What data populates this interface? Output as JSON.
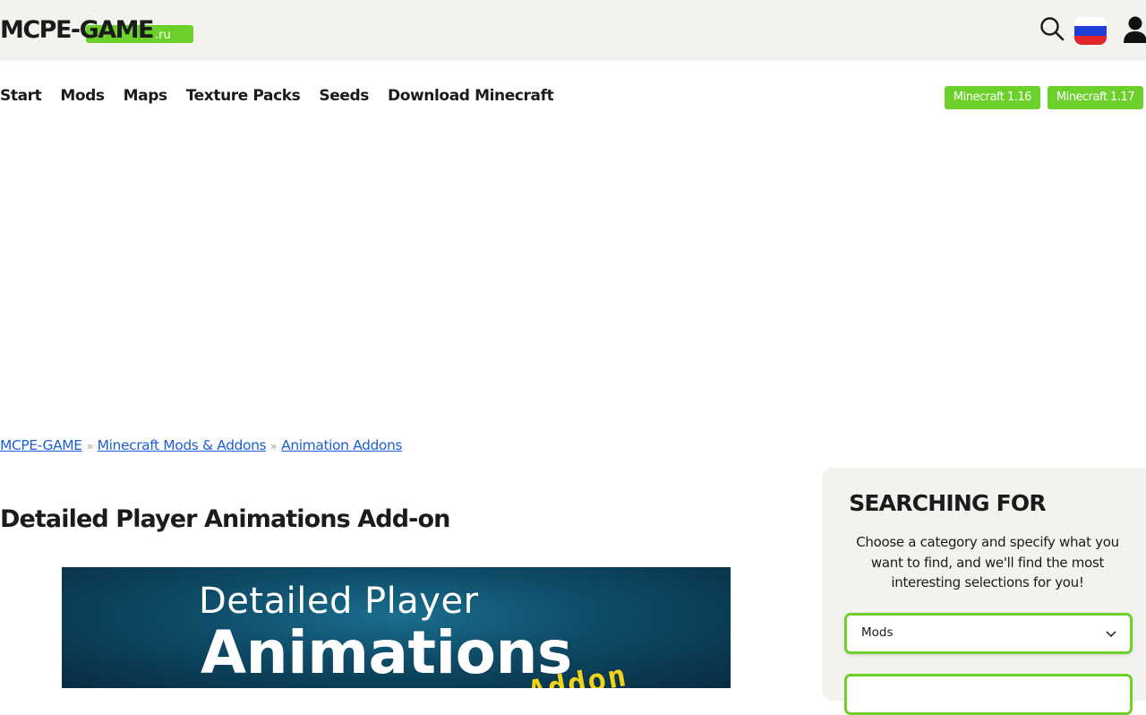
{
  "header": {
    "logo_text": "MCPE-GAME",
    "logo_suffix": ".ru",
    "icons": [
      "search-icon",
      "russia-flag-icon",
      "user-icon"
    ],
    "accent_color": "#6bd12a"
  },
  "nav": {
    "items": [
      {
        "label": "Start"
      },
      {
        "label": "Mods"
      },
      {
        "label": "Maps"
      },
      {
        "label": "Texture Packs"
      },
      {
        "label": "Seeds"
      },
      {
        "label": "Download Minecraft"
      }
    ],
    "versions": [
      {
        "label": "Minecraft 1.16"
      },
      {
        "label": "Minecraft 1.17"
      }
    ]
  },
  "breadcrumb": {
    "items": [
      {
        "label": "MCPE-GAME"
      },
      {
        "label": "Minecraft Mods & Addons"
      },
      {
        "label": "Animation Addons"
      }
    ],
    "separator": "»"
  },
  "main": {
    "title": "Detailed Player Animations Add-on",
    "hero": {
      "line1": "Detailed Player",
      "line2": "Animations",
      "line3": "Addon"
    }
  },
  "sidebar": {
    "title": "SEARCHING FOR",
    "description": "Choose a category and specify what you want to find, and we'll find the most interesting selections for you!",
    "category_select": {
      "value": "Mods"
    }
  }
}
